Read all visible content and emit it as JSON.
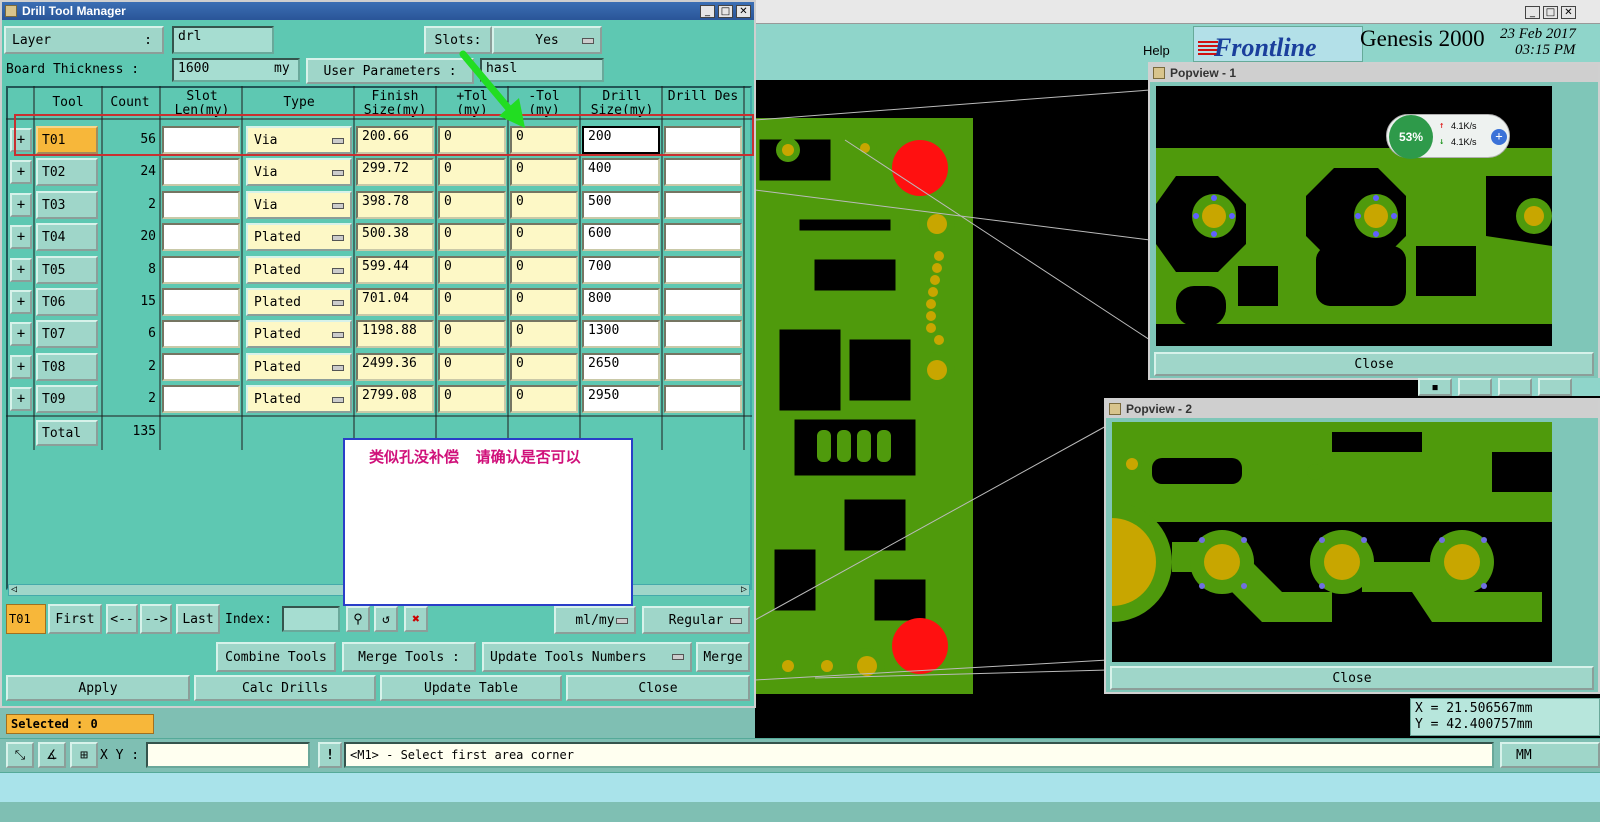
{
  "drill_window": {
    "title": "Drill Tool Manager",
    "layer_label": "Layer",
    "layer_colon": ":",
    "layer_value": "drl",
    "slots_label": "Slots:",
    "slots_value": "Yes",
    "board_thickness_label": "Board Thickness :",
    "board_thickness_value": "1600",
    "board_thickness_unit": "my",
    "user_params_label": "User Parameters :",
    "user_params_value": "hasl",
    "columns": [
      "Tool",
      "Count",
      "Slot Len(my)",
      "Type",
      "Finish Size(my)",
      "+Tol (my)",
      "-Tol (my)",
      "Drill Size(my)",
      "Drill Des"
    ],
    "rows": [
      {
        "tool": "T01",
        "count": "56",
        "slot": "",
        "type": "Via",
        "finish": "200.66",
        "ptol": "0",
        "mtol": "0",
        "drill": "200",
        "des": ""
      },
      {
        "tool": "T02",
        "count": "24",
        "slot": "",
        "type": "Via",
        "finish": "299.72",
        "ptol": "0",
        "mtol": "0",
        "drill": "400",
        "des": ""
      },
      {
        "tool": "T03",
        "count": "2",
        "slot": "",
        "type": "Via",
        "finish": "398.78",
        "ptol": "0",
        "mtol": "0",
        "drill": "500",
        "des": ""
      },
      {
        "tool": "T04",
        "count": "20",
        "slot": "",
        "type": "Plated",
        "finish": "500.38",
        "ptol": "0",
        "mtol": "0",
        "drill": "600",
        "des": ""
      },
      {
        "tool": "T05",
        "count": "8",
        "slot": "",
        "type": "Plated",
        "finish": "599.44",
        "ptol": "0",
        "mtol": "0",
        "drill": "700",
        "des": ""
      },
      {
        "tool": "T06",
        "count": "15",
        "slot": "",
        "type": "Plated",
        "finish": "701.04",
        "ptol": "0",
        "mtol": "0",
        "drill": "800",
        "des": ""
      },
      {
        "tool": "T07",
        "count": "6",
        "slot": "",
        "type": "Plated",
        "finish": "1198.88",
        "ptol": "0",
        "mtol": "0",
        "drill": "1300",
        "des": ""
      },
      {
        "tool": "T08",
        "count": "2",
        "slot": "",
        "type": "Plated",
        "finish": "2499.36",
        "ptol": "0",
        "mtol": "0",
        "drill": "2650",
        "des": ""
      },
      {
        "tool": "T09",
        "count": "2",
        "slot": "",
        "type": "Plated",
        "finish": "2799.08",
        "ptol": "0",
        "mtol": "0",
        "drill": "2950",
        "des": ""
      }
    ],
    "total_label": "Total",
    "total_value": "135",
    "nav": {
      "current": "T01",
      "first": "First",
      "prev": "<--",
      "next": "-->",
      "last": "Last",
      "index_label": "Index:",
      "units": "ml/my",
      "mode": "Regular"
    },
    "combine_tools": "Combine Tools",
    "merge_tools_label": "Merge Tools :",
    "update_tools_numbers": "Update Tools Numbers",
    "merge": "Merge",
    "apply": "Apply",
    "calc_drills": "Calc Drills",
    "update_table": "Update Table",
    "close": "Close"
  },
  "note": {
    "text": "类似孔没补偿    请确认是否可以"
  },
  "main_window": {
    "help": "Help",
    "brand": "Frontline",
    "product": "Genesis 2000",
    "date": "23 Feb 2017",
    "time": "03:15 PM",
    "selected": "Selected : 0",
    "xy_label": "X Y :",
    "status_message": "<M1> - Select first area corner",
    "coord_x": "X  = 21.506567mm",
    "coord_y": "Y  = 42.400757mm",
    "unit": "MM"
  },
  "popview1": {
    "title": "Popview - 1",
    "close": "Close",
    "net_percent": "53%",
    "up_speed": "4.1K/s",
    "down_speed": "4.1K/s"
  },
  "popview2": {
    "title": "Popview - 2",
    "close": "Close"
  },
  "colors": {
    "copper": "#4f9a0c",
    "pad": "#c8a600",
    "drill_red": "#ff1010",
    "panel_teal": "#5ec8b2",
    "highlight_red": "#c83030",
    "arrow_green": "#22dd22",
    "note_text": "#d0107a"
  }
}
